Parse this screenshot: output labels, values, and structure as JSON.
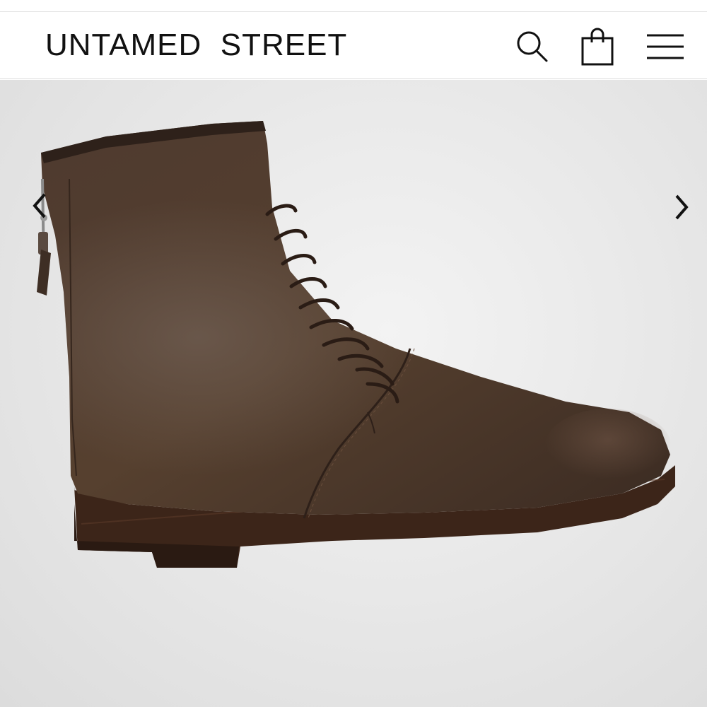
{
  "header": {
    "brand": "UNTAMED  STREET",
    "icons": {
      "search": "search-icon",
      "bag": "shopping-bag-icon",
      "menu": "hamburger-menu-icon"
    }
  },
  "gallery": {
    "product_image": "brown-leather-lace-up-boot",
    "prev_icon": "chevron-left-icon",
    "next_icon": "chevron-right-icon"
  },
  "colors": {
    "text": "#111111",
    "background": "#ffffff",
    "gallery_bg": "#e8e8e8",
    "leather": "#4a362b",
    "sole": "#3a2418"
  }
}
